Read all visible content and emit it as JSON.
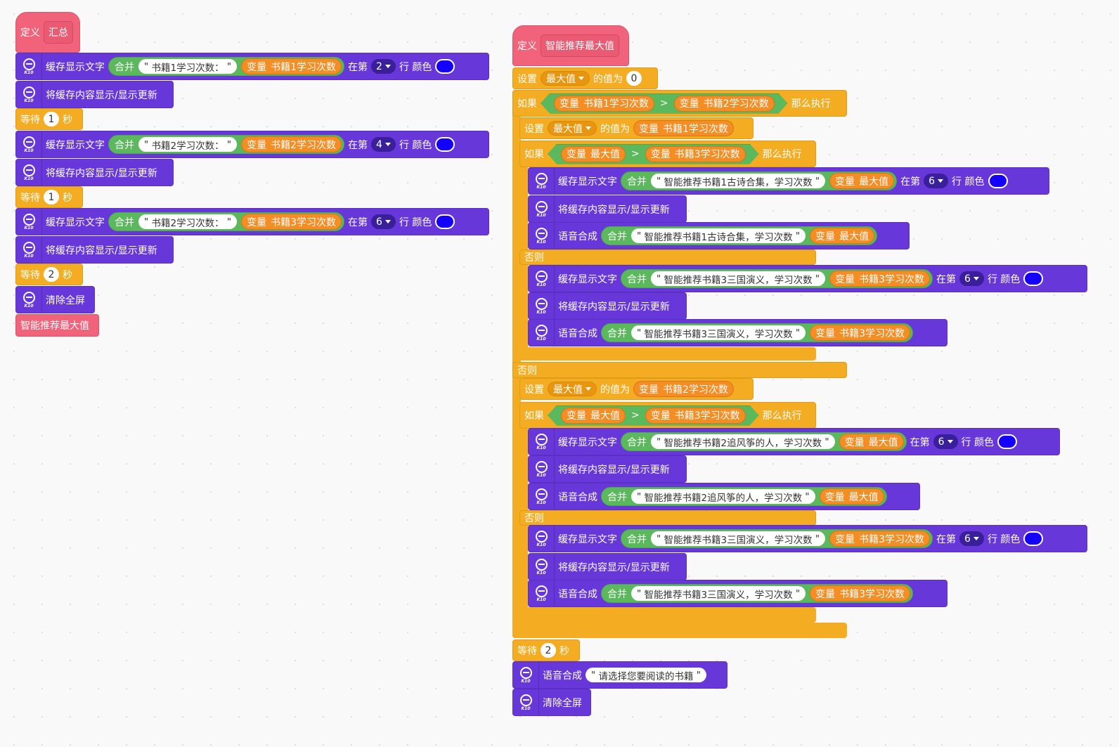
{
  "icons": {
    "extension": "k10-display-icon",
    "badge": "K10"
  },
  "colors": {
    "swatch": "#1400ff",
    "control": "#f4ad22",
    "extension": "#6737d9",
    "operator": "#5cb85c",
    "variable": "#f58d25",
    "define": "#f0637b"
  },
  "left": {
    "define": "定义",
    "define_name": "汇总",
    "cache_text": "缓存显示文字",
    "join": "合并",
    "at_row": "在第",
    "row_color": "行 颜色",
    "show_update": "将缓存内容显示/显示更新",
    "wait": "等待",
    "sec": "秒",
    "var": "变量",
    "clear": "清除全屏",
    "call": "智能推荐最大值",
    "rows": [
      {
        "str": "书籍1学习次数：",
        "var": "书籍1学习次数",
        "row": "2",
        "wait": "1"
      },
      {
        "str": "书籍2学习次数：",
        "var": "书籍2学习次数",
        "row": "4",
        "wait": "1"
      },
      {
        "str": "书籍2学习次数：",
        "var": "书籍3学习次数",
        "row": "6",
        "wait": "2"
      }
    ]
  },
  "right": {
    "define": "定义",
    "define_name": "智能推荐最大值",
    "set": "设置",
    "maxvar": "最大值",
    "value_of": "的值为",
    "zero": "0",
    "if": "如果",
    "then": "那么执行",
    "else": "否则",
    "gt": ">",
    "var": "变量",
    "join": "合并",
    "cache_text": "缓存显示文字",
    "at_row": "在第",
    "row_color": "行 颜色",
    "row": "6",
    "show_update": "将缓存内容显示/显示更新",
    "tts": "语音合成",
    "wait": "等待",
    "wait_val": "2",
    "sec": "秒",
    "clear": "清除全屏",
    "v_b1": "书籍1学习次数",
    "v_b2": "书籍2学习次数",
    "v_b3": "书籍3学习次数",
    "v_max": "最大值",
    "s1": "智能推荐书籍1古诗合集，学习次数",
    "s3": "智能推荐书籍3三国演义，学习次数",
    "s2": "智能推荐书籍2追风筝的人，学习次数",
    "choose": "请选择您要阅读的书籍"
  }
}
